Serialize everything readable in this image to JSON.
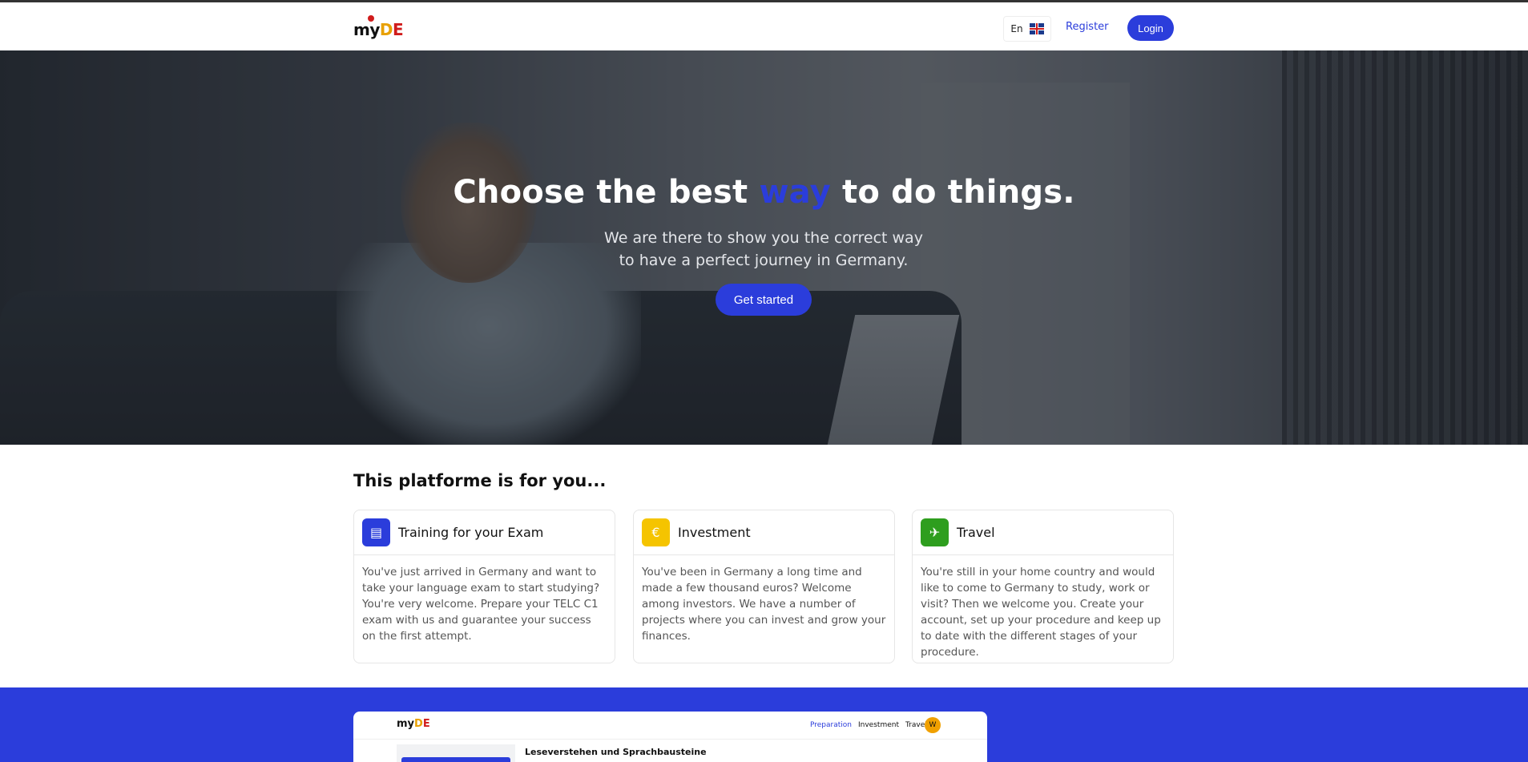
{
  "header": {
    "logo": {
      "my": "my",
      "d": "D",
      "e": "E"
    },
    "language": {
      "code": "En",
      "flag_icon": "uk-flag-icon"
    },
    "register_label": "Register",
    "login_label": "Login"
  },
  "hero": {
    "title_before": "Choose the best ",
    "title_accent": "way",
    "title_after": " to do things.",
    "subtitle": "We are there to show you the correct way to have a perfect journey in Germany.",
    "cta_label": "Get started"
  },
  "platform": {
    "title": "This platforme is for you...",
    "cards": [
      {
        "icon": "book-icon",
        "icon_glyph": "▤",
        "color": "#2b3ddb",
        "title": "Training for your Exam",
        "text": "You've just arrived in Germany and want to take your language exam to start studying? You're very welcome. Prepare your TELC C1 exam with us and guarantee your success on the first attempt."
      },
      {
        "icon": "euro-icon",
        "icon_glyph": "€",
        "color": "#f5c400",
        "title": "Investment",
        "text": "You've been in Germany a long time and made a few thousand euros? Welcome among investors. We have a number of projects where you can invest and grow your finances."
      },
      {
        "icon": "plane-icon",
        "icon_glyph": "✈",
        "color": "#2e9e1e",
        "title": "Travel",
        "text": "You're still in your home country and would like to come to Germany to study, work or visit? Then we welcome you. Create your account, set up your procedure and keep up to date with the different stages of your procedure."
      }
    ]
  },
  "preview": {
    "logo": {
      "my": "my",
      "d": "D",
      "e": "E"
    },
    "nav": [
      "Preparation",
      "Investment",
      "Travel"
    ],
    "avatar": "W",
    "heading": "Leseverstehen und Sprachbausteine"
  },
  "colors": {
    "brand": "#2b3ddb",
    "logo_yellow": "#e8a000",
    "logo_red": "#d01c1c"
  }
}
